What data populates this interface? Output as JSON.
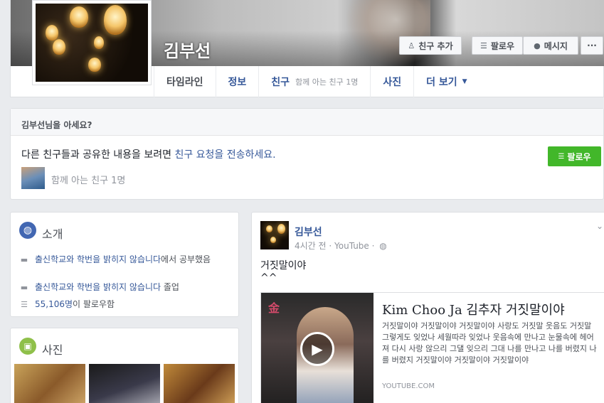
{
  "profile": {
    "name": "김부선",
    "buttons": {
      "add_friend": "친구 추가",
      "follow": "팔로우",
      "message": "메시지",
      "more": "···"
    },
    "nav": {
      "timeline": "타임라인",
      "about": "정보",
      "friends": "친구",
      "friends_sub": "함께 아는 친구 1명",
      "photos": "사진",
      "more": "더 보기"
    }
  },
  "know_card": {
    "header": "김부선님을 아세요?",
    "body_prefix": "다른 친구들과 공유한 내용을 보려면 ",
    "body_link": "친구 요청을 전송하세요.",
    "follow_button": "팔로우",
    "mutual": "함께 아는 친구 1명"
  },
  "intro": {
    "title": "소개",
    "rows": [
      {
        "link": "출신학교와 학번을 밝히지 않습니다",
        "suffix": "에서 공부했음"
      },
      {
        "link": "출신학교와 학번을 밝히지 않습니다",
        "suffix": " 졸업"
      },
      {
        "link": "55,106명",
        "suffix": "이 팔로우함"
      }
    ]
  },
  "photos": {
    "title": "사진"
  },
  "post": {
    "author": "김부선",
    "meta": "4시간 전 · YouTube ·",
    "text": "거짓말이야\n^^",
    "link_preview": {
      "title": "Kim Choo Ja 김추자 거짓말이야",
      "description": "거짓말이야 거짓말이야 거짓말이야 사랑도 거짓말 웃음도 거짓말 그렇게도 잊었나 세월따라 잊었나 웃음속에 만나고 눈물속에 헤어져 다시 사랑 않으리 그댈 잊으리 그대 나를 만나고 나를 버렸지 나를 버렸지 거짓말이야 거짓말이야 거짓말이야",
      "source": "YOUTUBE.COM"
    }
  }
}
